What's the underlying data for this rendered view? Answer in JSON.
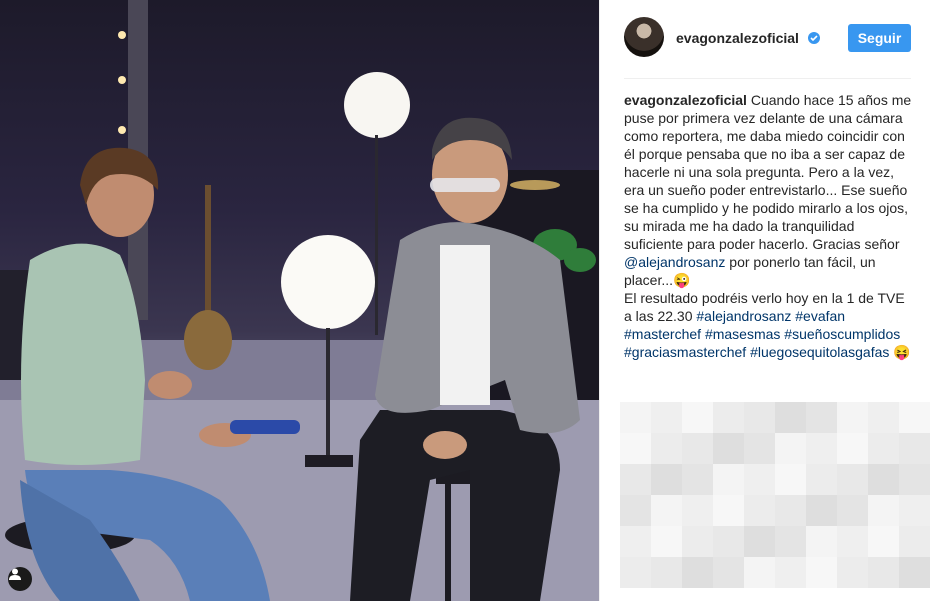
{
  "post": {
    "username": "evagonzalezoficial",
    "follow_label": "Seguir",
    "caption_segments": [
      {
        "text": "Cuando hace 15 años me puse por primera vez delante de una cámara como reportera, me daba miedo coincidir con él porque pensaba que no iba a ser capaz de hacerle ni una sola pregunta. Pero a la vez, era un sueño poder entrevistarlo... Ese sueño se ha cumplido y he podido mirarlo a los ojos, su mirada me ha dado la tranquilidad suficiente para poder hacerlo. Gracias señor ",
        "type": "text"
      },
      {
        "text": "@alejandrosanz",
        "type": "link"
      },
      {
        "text": " por ponerlo tan fácil, un placer...😜",
        "type": "text"
      }
    ],
    "caption_line2_segments": [
      {
        "text": "El resultado podréis verlo hoy en la 1 de TVE a las 22.30 ",
        "type": "text"
      },
      {
        "text": "#alejandrosanz",
        "type": "link"
      },
      {
        "text": " ",
        "type": "text"
      },
      {
        "text": "#evafan",
        "type": "link"
      },
      {
        "text": " ",
        "type": "text"
      },
      {
        "text": "#masterchef",
        "type": "link"
      },
      {
        "text": " ",
        "type": "text"
      },
      {
        "text": "#masesmas",
        "type": "link"
      },
      {
        "text": " ",
        "type": "text"
      },
      {
        "text": "#sueñoscumplidos",
        "type": "link"
      },
      {
        "text": " ",
        "type": "text"
      },
      {
        "text": "#graciasmasterchef",
        "type": "link"
      },
      {
        "text": " ",
        "type": "text"
      },
      {
        "text": "#luegosequitolasgafas",
        "type": "link"
      },
      {
        "text": " 😝",
        "type": "text"
      }
    ]
  },
  "icons": {
    "user_tag": "person-icon",
    "verified": "verified-badge-icon"
  },
  "colors": {
    "accent": "#3897f0",
    "link": "#003569",
    "text": "#262626"
  }
}
